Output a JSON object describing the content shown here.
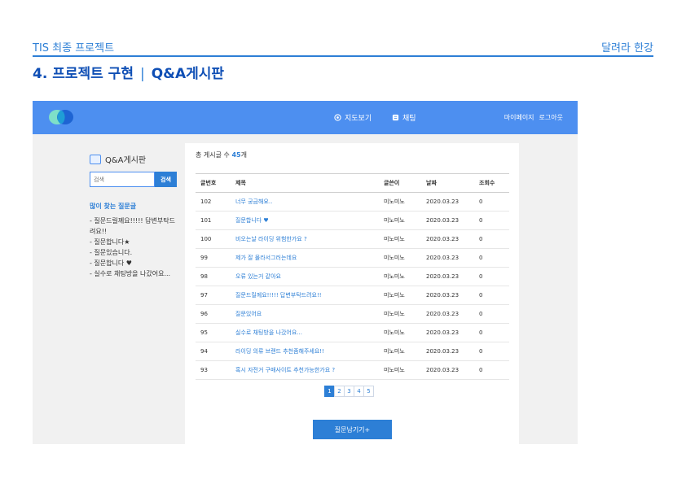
{
  "slide": {
    "top_left": "TIS 최종 프로젝트",
    "top_right": "달려라 한강",
    "title_main": "4. 프로젝트 구현",
    "title_sep": "|",
    "title_sub": "Q&A게시판"
  },
  "colors": {
    "brand": "#4d8ff0",
    "accent": "#2d7fd6",
    "title": "#0f4fb5"
  },
  "nav": {
    "items": [
      {
        "label": "지도보기",
        "icon": "map-icon"
      },
      {
        "label": "채팅",
        "icon": "chat-icon"
      }
    ],
    "mypage": "마이페이지",
    "logout": "로그아웃"
  },
  "sidebar": {
    "title": "Q&A게시판",
    "search_placeholder": "검색",
    "search_button": "검색",
    "faq_title": "많이 찾는 질문글",
    "faq": [
      "- 질문드릴께요!!!!! 답변부탁드려요!!",
      "- 질문합니다★",
      "- 질문있습니다.",
      "- 질문합니다 ♥",
      "- 실수로 채팅방을 나갔어요..."
    ]
  },
  "board": {
    "count_prefix": "총 게시글 수 ",
    "count": "45",
    "count_suffix": "개",
    "columns": [
      "글번호",
      "제목",
      "글쓴이",
      "날짜",
      "조회수"
    ],
    "rows": [
      [
        "102",
        "너무 궁금해요..",
        "미노미노",
        "2020.03.23",
        "0"
      ],
      [
        "101",
        "질문합니다 ♥",
        "미노미노",
        "2020.03.23",
        "0"
      ],
      [
        "100",
        "비오는날 라이딩 위험한가요 ?",
        "미노미노",
        "2020.03.23",
        "0"
      ],
      [
        "99",
        "제가 잘 몰라서그러는데요",
        "미노미노",
        "2020.03.23",
        "0"
      ],
      [
        "98",
        "오류 있는거 같아요",
        "미노미노",
        "2020.03.23",
        "0"
      ],
      [
        "97",
        "질문드릴께요!!!!! 답변부탁드려요!!",
        "미노미노",
        "2020.03.23",
        "0"
      ],
      [
        "96",
        "질문있어요",
        "미노미노",
        "2020.03.23",
        "0"
      ],
      [
        "95",
        "실수로 채팅방을 나갔어요...",
        "미노미노",
        "2020.03.23",
        "0"
      ],
      [
        "94",
        "라이딩 의류 브랜드 추천좀해주세요!!",
        "미노미노",
        "2020.03.23",
        "0"
      ],
      [
        "93",
        "혹시 자전거 구매사이트 추천가능한가요 ?",
        "미노미노",
        "2020.03.23",
        "0"
      ]
    ],
    "pages": [
      "1",
      "2",
      "3",
      "4",
      "5"
    ],
    "active_page": "1",
    "ask_button": "질문남기기+"
  }
}
